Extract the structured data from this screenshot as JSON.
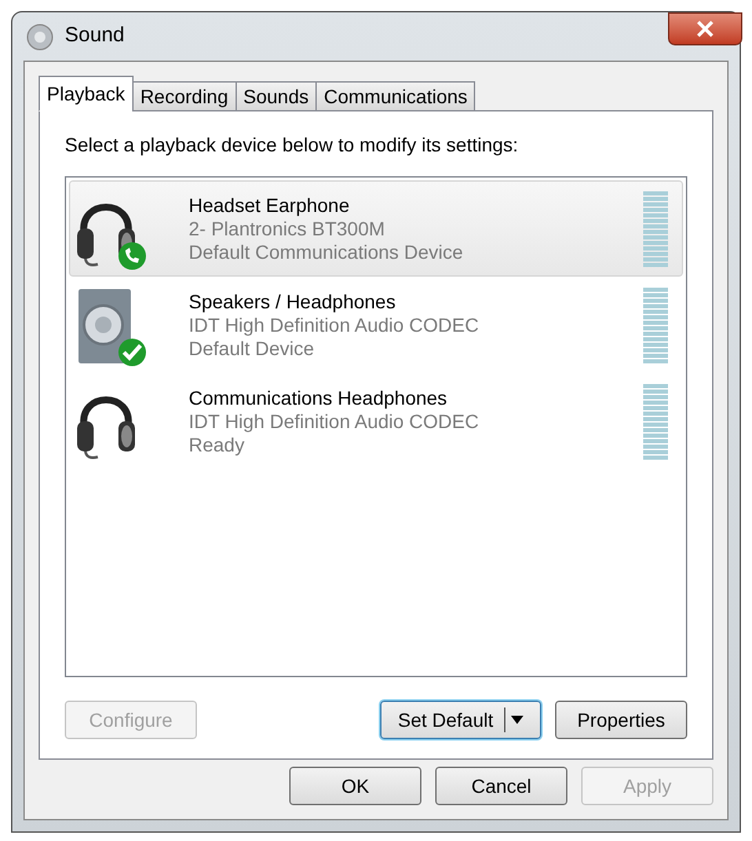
{
  "window": {
    "title": "Sound"
  },
  "tabs": [
    {
      "label": "Playback",
      "selected": true
    },
    {
      "label": "Recording",
      "selected": false
    },
    {
      "label": "Sounds",
      "selected": false
    },
    {
      "label": "Communications",
      "selected": false
    }
  ],
  "instruction": "Select a playback device below to modify its settings:",
  "devices": [
    {
      "kind": "headset",
      "default_device": false,
      "default_communications": true,
      "name": "Headset Earphone",
      "driver": "2- Plantronics BT300M",
      "status": "Default Communications Device",
      "selected": true
    },
    {
      "kind": "speaker",
      "default_device": true,
      "default_communications": false,
      "name": "Speakers / Headphones",
      "driver": "IDT High Definition Audio CODEC",
      "status": "Default Device",
      "selected": false
    },
    {
      "kind": "headset",
      "default_device": false,
      "default_communications": false,
      "name": "Communications Headphones",
      "driver": "IDT High Definition Audio CODEC",
      "status": "Ready",
      "selected": false
    }
  ],
  "panel_buttons": [
    {
      "label": "Configure",
      "disabled": true,
      "kind": "plain",
      "focused": false
    },
    {
      "label": "Set Default",
      "disabled": false,
      "kind": "split",
      "focused": true
    },
    {
      "label": "Properties",
      "disabled": false,
      "kind": "plain",
      "focused": false
    }
  ],
  "dialog_buttons": [
    {
      "label": "OK",
      "disabled": false
    },
    {
      "label": "Cancel",
      "disabled": false
    },
    {
      "label": "Apply",
      "disabled": true
    }
  ]
}
